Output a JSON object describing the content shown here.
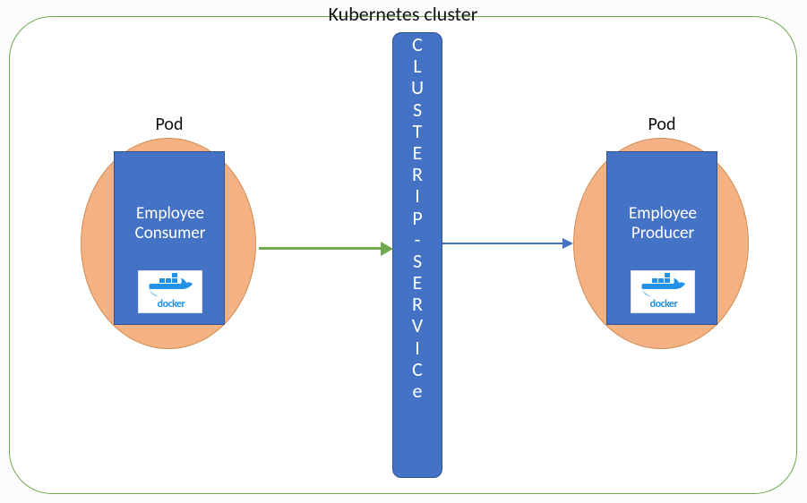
{
  "cluster": {
    "title": "Kubernetes cluster"
  },
  "pods": {
    "left": {
      "label": "Pod",
      "container_line1": "Employee",
      "container_line2": "Consumer",
      "docker_label": "docker"
    },
    "right": {
      "label": "Pod",
      "container_line1": "Employee",
      "container_line2": "Producer",
      "docker_label": "docker"
    }
  },
  "service": {
    "letters": [
      "C",
      "L",
      "U",
      "S",
      "T",
      "E",
      "R",
      "I",
      "P",
      "-",
      "S",
      "E",
      "R",
      "V",
      "I",
      "C",
      "e"
    ]
  },
  "arrows": {
    "left_to_service": {
      "color": "#6fa84f"
    },
    "service_to_right": {
      "color": "#4472c4"
    }
  }
}
